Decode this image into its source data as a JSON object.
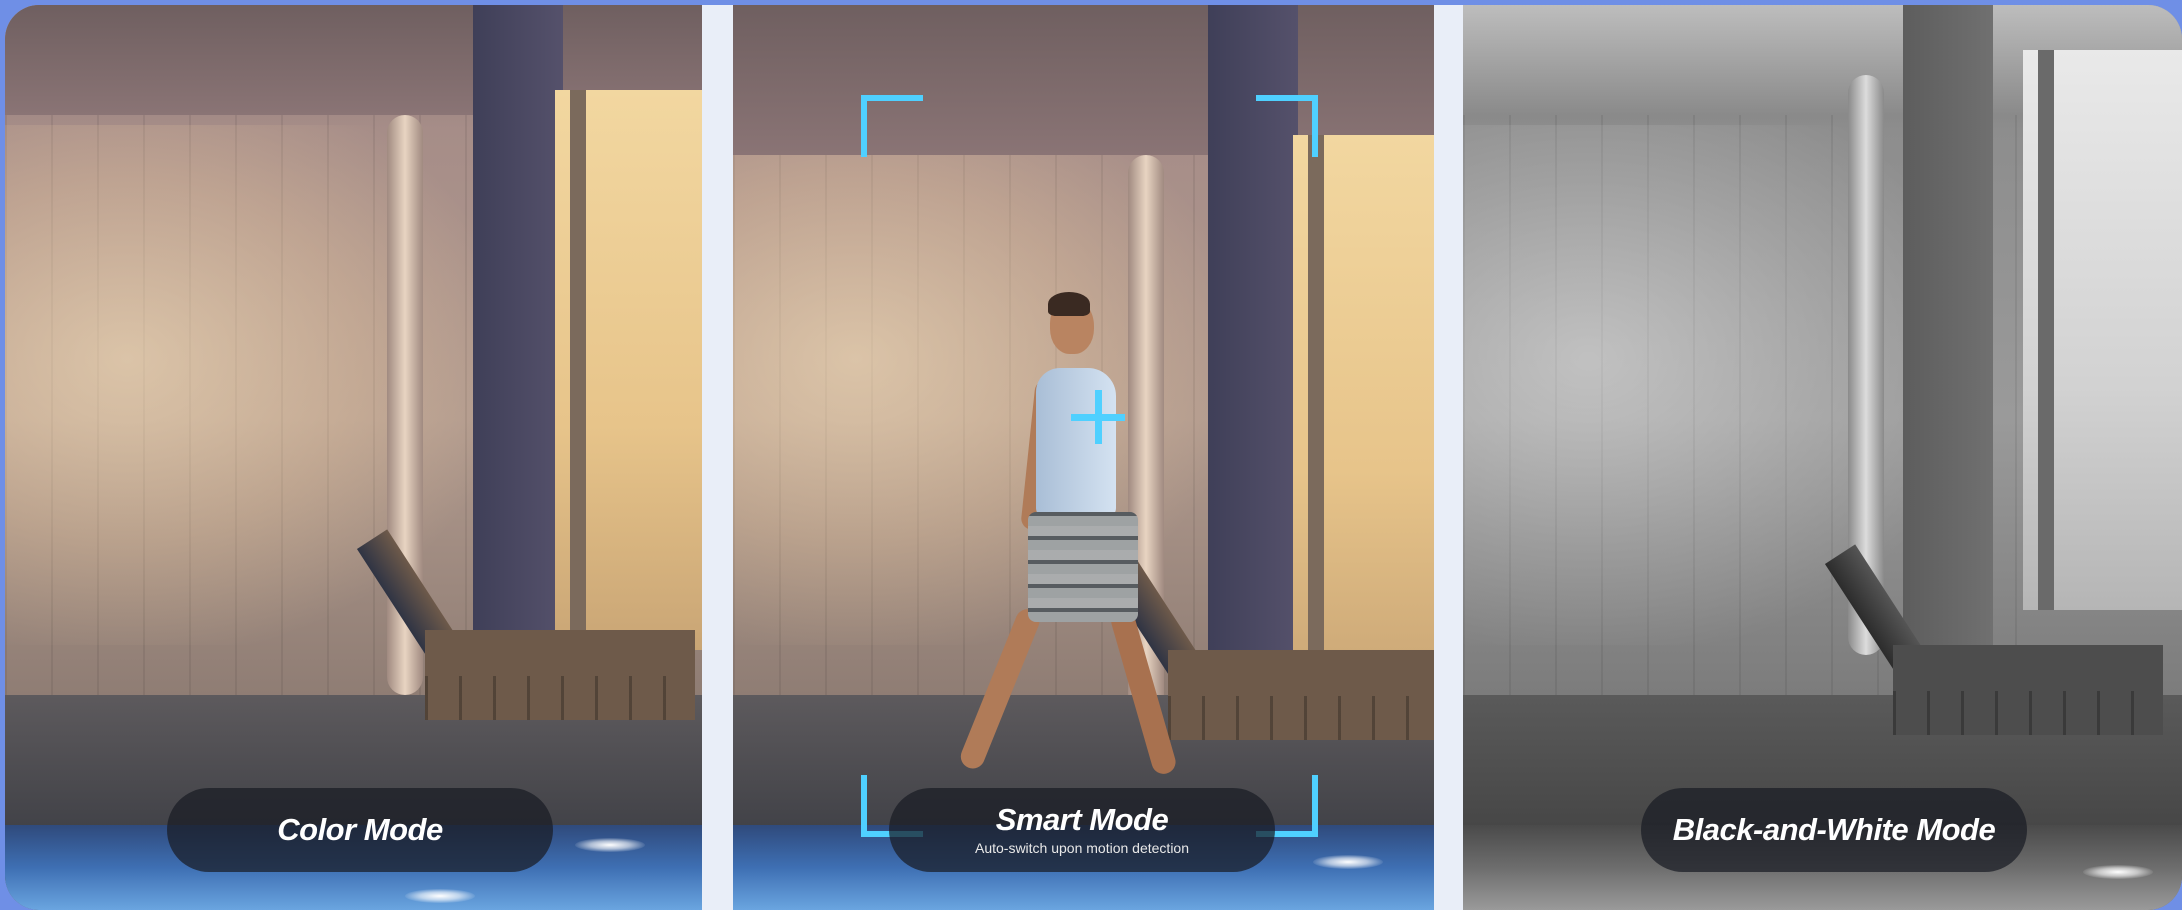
{
  "panels": [
    {
      "id": "color",
      "title": "Color Mode"
    },
    {
      "id": "smart",
      "title": "Smart Mode",
      "subtitle": "Auto-switch upon motion detection"
    },
    {
      "id": "bw",
      "title": "Black-and-White Mode"
    }
  ],
  "colors": {
    "frame_border": "#6f8fe6",
    "divider": "#e9eef8",
    "tracking_accent": "#4fd0ff",
    "label_pill": "#191c24"
  }
}
